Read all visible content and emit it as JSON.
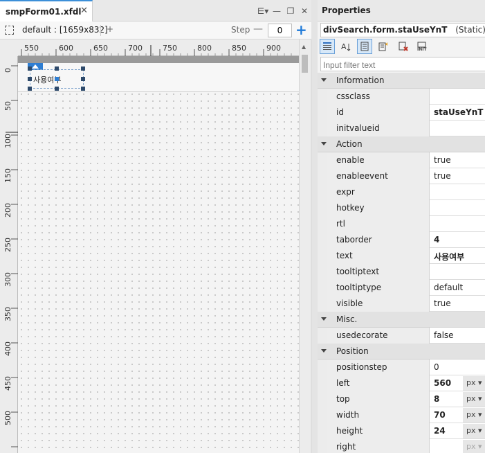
{
  "designer": {
    "tab_title": "smpForm01.xfdl",
    "close_glyph": "✕",
    "window_buttons": [
      "⋿▾",
      "—",
      "❐",
      "✕"
    ],
    "layout_label": "default : [1659x832]",
    "add_glyph": "+",
    "step_label": "Step",
    "step_minus": "—",
    "step_value": "0",
    "step_plus": "+",
    "ruler_x": [
      "550",
      "600",
      "650",
      "700",
      "750",
      "800",
      "850",
      "900"
    ],
    "ruler_y": [
      "0",
      "50",
      "100",
      "150",
      "200",
      "250",
      "300",
      "350",
      "400",
      "450",
      "500"
    ],
    "static_text": "사용여부"
  },
  "properties": {
    "title": "Properties",
    "object_name": "divSearch.form.staUseYnT",
    "object_type": "(Static)",
    "filter_placeholder": "Input filter text",
    "groups": [
      {
        "name": "Information",
        "props": [
          {
            "name": "cssclass",
            "value": ""
          },
          {
            "name": "id",
            "value": "staUseYnT",
            "bold": true
          },
          {
            "name": "initvalueid",
            "value": ""
          }
        ]
      },
      {
        "name": "Action",
        "props": [
          {
            "name": "enable",
            "value": "true"
          },
          {
            "name": "enableevent",
            "value": "true"
          },
          {
            "name": "expr",
            "value": ""
          },
          {
            "name": "hotkey",
            "value": ""
          },
          {
            "name": "rtl",
            "value": ""
          },
          {
            "name": "taborder",
            "value": "4",
            "bold": true
          },
          {
            "name": "text",
            "value": "사용여부",
            "bold": true
          },
          {
            "name": "tooltiptext",
            "value": ""
          },
          {
            "name": "tooltiptype",
            "value": "default"
          },
          {
            "name": "visible",
            "value": "true"
          }
        ]
      },
      {
        "name": "Misc.",
        "props": [
          {
            "name": "usedecorate",
            "value": "false"
          }
        ]
      },
      {
        "name": "Position",
        "props": [
          {
            "name": "positionstep",
            "value": "0"
          },
          {
            "name": "left",
            "value": "560",
            "bold": true,
            "unit": "px ▾"
          },
          {
            "name": "top",
            "value": "8",
            "bold": true,
            "unit": "px ▾"
          },
          {
            "name": "width",
            "value": "70",
            "bold": true,
            "unit": "px ▾"
          },
          {
            "name": "height",
            "value": "24",
            "bold": true,
            "unit": "px ▾"
          },
          {
            "name": "right",
            "value": "",
            "unit": "px ▾",
            "unit_dim": true
          }
        ]
      }
    ]
  }
}
